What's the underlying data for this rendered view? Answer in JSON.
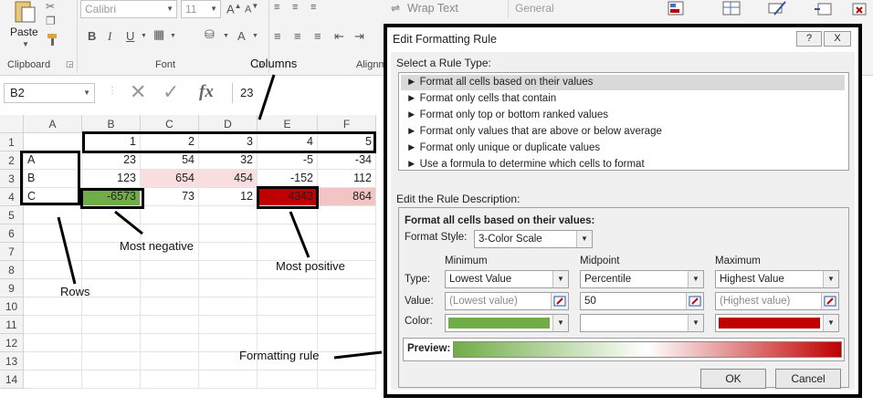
{
  "ribbon": {
    "paste_label": "Paste",
    "clipboard_label": "Clipboard",
    "font_label": "Font",
    "alignment_label": "Alignm",
    "font_name": "Calibri",
    "font_size": "11",
    "wrap_text": "Wrap Text",
    "number_format": "General"
  },
  "formula_bar": {
    "name_box": "B2",
    "fx": "fx",
    "value": "23"
  },
  "grid": {
    "col_headers": [
      "A",
      "B",
      "C",
      "D",
      "E",
      "F"
    ],
    "row_headers": [
      "1",
      "2",
      "3",
      "4",
      "5",
      "6",
      "7",
      "8",
      "9",
      "10",
      "11",
      "12",
      "13",
      "14"
    ],
    "rows": [
      [
        "",
        "1",
        "2",
        "3",
        "4",
        "5"
      ],
      [
        "A",
        "23",
        "54",
        "32",
        "-5",
        "-34"
      ],
      [
        "B",
        "123",
        "654",
        "454",
        "-152",
        "112"
      ],
      [
        "C",
        "-6573",
        "73",
        "12",
        "4343",
        "864"
      ]
    ]
  },
  "annotations": {
    "columns": "Columns",
    "rows": "Rows",
    "most_negative": "Most negative",
    "most_positive": "Most positive",
    "formatting_rule": "Formatting rule"
  },
  "dialog": {
    "title": "Edit Formatting Rule",
    "help_btn": "?",
    "close_btn": "X",
    "select_rule_type": "Select a Rule Type:",
    "rules": [
      "► Format all cells based on their values",
      "► Format only cells that contain",
      "► Format only top or bottom ranked values",
      "► Format only values that are above or below average",
      "► Format only unique or duplicate values",
      "► Use a formula to determine which cells to format"
    ],
    "edit_rule_desc": "Edit the Rule Description:",
    "format_all_label": "Format all cells based on their values:",
    "format_style_label": "Format Style:",
    "format_style_value": "3-Color Scale",
    "minimum": "Minimum",
    "midpoint": "Midpoint",
    "maximum": "Maximum",
    "type_label": "Type:",
    "value_label": "Value:",
    "color_label": "Color:",
    "min_type": "Lowest Value",
    "mid_type": "Percentile",
    "max_type": "Highest Value",
    "min_value": "(Lowest value)",
    "mid_value": "50",
    "max_value": "(Highest value)",
    "preview_label": "Preview:",
    "ok": "OK",
    "cancel": "Cancel"
  },
  "colors": {
    "min_color": "#70ad47",
    "mid_color": "#ffffff",
    "max_color": "#c00000",
    "pink_light": "#f8dede",
    "pink_mid": "#f2c4c4"
  }
}
